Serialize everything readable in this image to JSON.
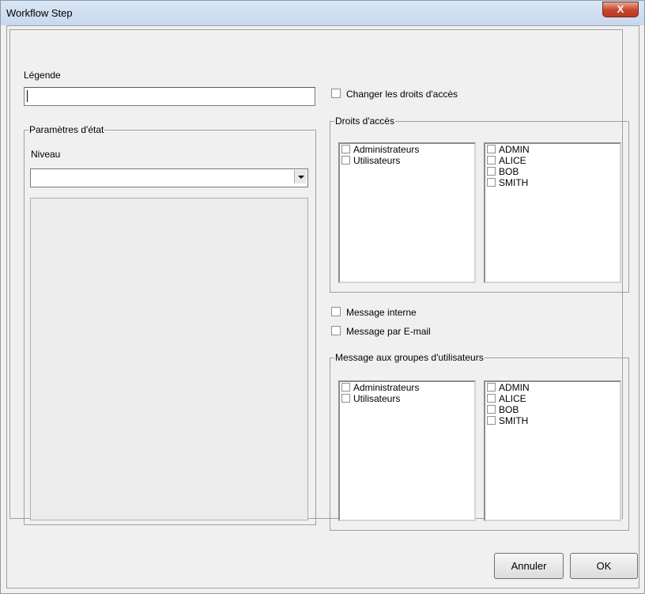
{
  "window": {
    "title": "Workflow Step",
    "close_label": "X"
  },
  "legende": {
    "label": "Légende",
    "value": ""
  },
  "etat": {
    "group_label": "Paramètres d'état",
    "niveau_label": "Niveau",
    "niveau_value": ""
  },
  "changer_droits": {
    "label": "Changer les droits d'accès",
    "checked": false
  },
  "droits": {
    "group_label": "Droits d'accès",
    "groups": [
      "Administrateurs",
      "Utilisateurs"
    ],
    "users": [
      "ADMIN",
      "ALICE",
      "BOB",
      "SMITH"
    ]
  },
  "message_interne": {
    "label": "Message interne",
    "checked": false
  },
  "message_email": {
    "label": "Message par E-mail",
    "checked": false
  },
  "message_groupes": {
    "group_label": "Message aux groupes d'utilisateurs",
    "groups": [
      "Administrateurs",
      "Utilisateurs"
    ],
    "users": [
      "ADMIN",
      "ALICE",
      "BOB",
      "SMITH"
    ]
  },
  "buttons": {
    "cancel": "Annuler",
    "ok": "OK"
  }
}
